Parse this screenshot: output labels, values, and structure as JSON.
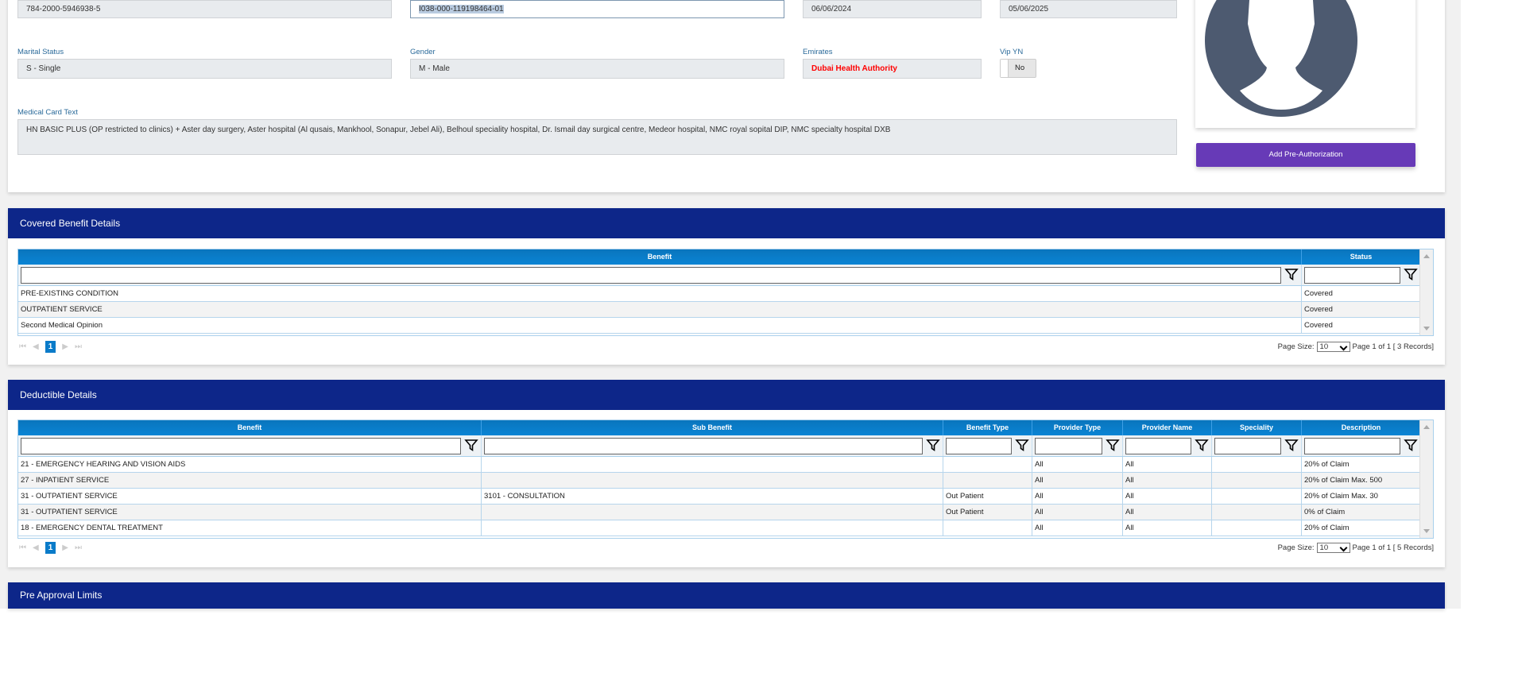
{
  "member": {
    "row1": [
      "784-2000-5946938-5",
      "I038-000-119198464-01",
      "06/06/2024",
      "05/06/2025"
    ],
    "marital_label": "Marital Status",
    "marital_value": "S - Single",
    "gender_label": "Gender",
    "gender_value": "M - Male",
    "emirates_label": "Emirates",
    "emirates_value": "Dubai Health Authority",
    "vip_label": "Vip YN",
    "vip_value": "No",
    "card_text_label": "Medical Card Text",
    "card_text": "HN BASIC PLUS (OP restricted to clinics) + Aster day surgery, Aster hospital (Al qusais, Mankhool, Sonapur, Jebel Ali), Belhoul speciality hospital, Dr. Ismail day surgical centre, Medeor hospital, NMC royal sopital DIP,  NMC specialty hospital DXB",
    "add_preauth": "Add Pre-Authorization"
  },
  "colors": {
    "header": "#0d2689",
    "table_header": "#0a7bc9",
    "button": "#673ab7",
    "emirates": "#ff0000"
  },
  "covered": {
    "title": "Covered Benefit Details",
    "columns": [
      "Benefit",
      "Status"
    ],
    "rows": [
      [
        "PRE-EXISTING CONDITION",
        "Covered"
      ],
      [
        "OUTPATIENT SERVICE",
        "Covered"
      ],
      [
        "Second Medical Opinion",
        "Covered"
      ]
    ],
    "page": "1",
    "page_size_label": "Page Size:",
    "page_size": "10",
    "page_info": "Page 1 of 1 [ 3 Records]"
  },
  "deductible": {
    "title": "Deductible Details",
    "columns": [
      "Benefit",
      "Sub Benefit",
      "Benefit Type",
      "Provider Type",
      "Provider Name",
      "Speciality",
      "Description"
    ],
    "rows": [
      [
        "21 - EMERGENCY HEARING AND VISION AIDS",
        "",
        "",
        "All",
        "All",
        "",
        "20% of Claim"
      ],
      [
        "27 - INPATIENT SERVICE",
        "",
        "",
        "All",
        "All",
        "",
        "20% of Claim Max. 500"
      ],
      [
        "31 - OUTPATIENT SERVICE",
        "3101 - CONSULTATION",
        "Out Patient",
        "All",
        "All",
        "",
        "20% of Claim Max. 30"
      ],
      [
        "31 - OUTPATIENT SERVICE",
        "",
        "Out Patient",
        "All",
        "All",
        "",
        "0% of Claim"
      ],
      [
        "18 - EMERGENCY DENTAL TREATMENT",
        "",
        "",
        "All",
        "All",
        "",
        "20% of Claim"
      ]
    ],
    "page": "1",
    "page_size_label": "Page Size:",
    "page_size": "10",
    "page_info": "Page 1 of 1 [ 5 Records]"
  },
  "preapproval": {
    "title": "Pre Approval Limits"
  }
}
